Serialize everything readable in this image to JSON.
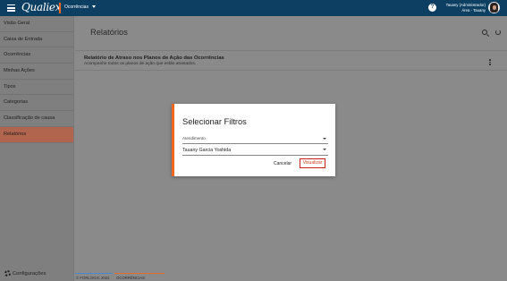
{
  "topbar": {
    "logo": "Qualiex",
    "module": "Ocorrências",
    "help": "?",
    "user_name": "Tauany (Administrador)",
    "user_sub": "Área - Tauany"
  },
  "sidebar": {
    "items": [
      {
        "label": "Visão Geral"
      },
      {
        "label": "Caixa de Entrada"
      },
      {
        "label": "Ocorrências"
      },
      {
        "label": "Minhas Ações"
      },
      {
        "label": "Tipos"
      },
      {
        "label": "Categorias"
      },
      {
        "label": "Classificação de causa"
      },
      {
        "label": "Relatórios"
      }
    ],
    "active_index": 7,
    "config_label": "Configurações"
  },
  "main": {
    "title": "Relatórios",
    "card_title": "Relatório de Atraso nos Planos de Ação das Ocorrências",
    "card_subtitle": "Acompanhe todos os planos de ação que estão atrasados."
  },
  "footer": {
    "copyright": "© FORLOGIC 2022",
    "module": "OCORRÊNCIAS"
  },
  "modal": {
    "title": "Selecionar Filtros",
    "field1_label": "Atendimento",
    "field2_value": "Tauany Garcia Yoshida",
    "cancel_label": "Cancelar",
    "view_label": "Visualizar"
  },
  "colors": {
    "topbar": "#0d3f63",
    "accent": "#f0661e",
    "active_item": "#b1654f",
    "view_button_border": "#d11d1d"
  }
}
